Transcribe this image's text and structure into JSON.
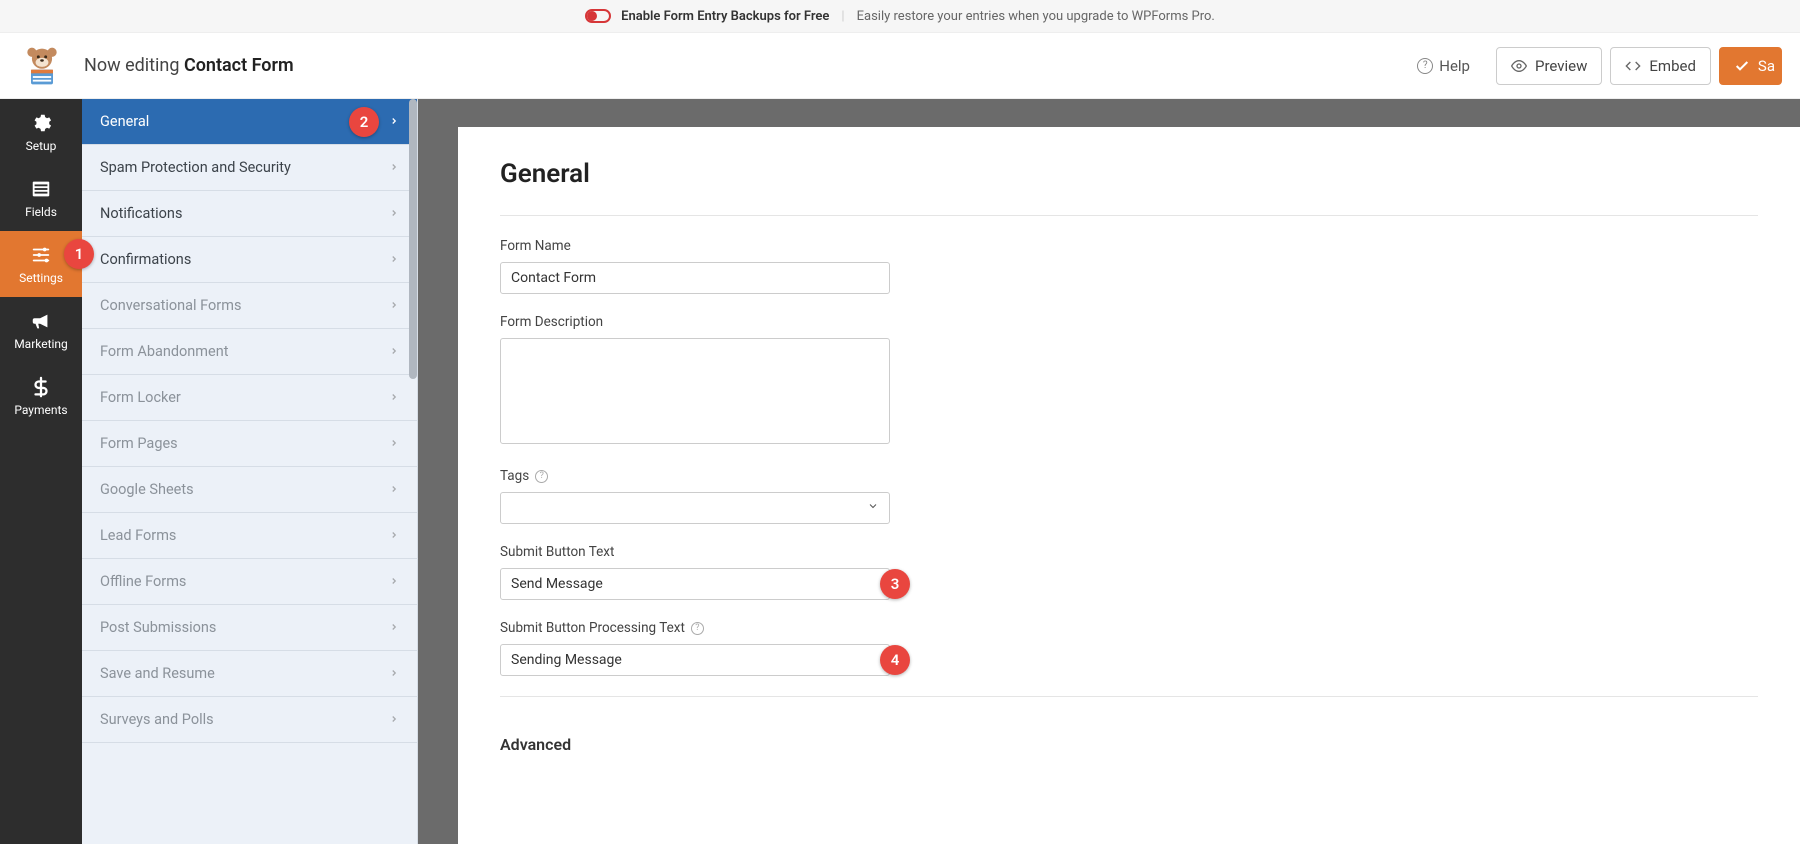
{
  "promo": {
    "title": "Enable Form Entry Backups for Free",
    "subtitle": "Easily restore your entries when you upgrade to WPForms Pro."
  },
  "header": {
    "editing_prefix": "Now editing",
    "form_name": "Contact Form",
    "help": "Help",
    "preview": "Preview",
    "embed": "Embed",
    "save": "Sa"
  },
  "rail": {
    "items": [
      {
        "label": "Setup",
        "icon": "gear"
      },
      {
        "label": "Fields",
        "icon": "list"
      },
      {
        "label": "Settings",
        "icon": "sliders",
        "active": true,
        "badge": "1"
      },
      {
        "label": "Marketing",
        "icon": "bullhorn"
      },
      {
        "label": "Payments",
        "icon": "dollar"
      }
    ]
  },
  "sidebar": {
    "items": [
      {
        "label": "General",
        "active": true,
        "badge": "2"
      },
      {
        "label": "Spam Protection and Security"
      },
      {
        "label": "Notifications"
      },
      {
        "label": "Confirmations"
      },
      {
        "label": "Conversational Forms",
        "dim": true
      },
      {
        "label": "Form Abandonment",
        "dim": true
      },
      {
        "label": "Form Locker",
        "dim": true
      },
      {
        "label": "Form Pages",
        "dim": true
      },
      {
        "label": "Google Sheets",
        "dim": true
      },
      {
        "label": "Lead Forms",
        "dim": true
      },
      {
        "label": "Offline Forms",
        "dim": true
      },
      {
        "label": "Post Submissions",
        "dim": true
      },
      {
        "label": "Save and Resume",
        "dim": true
      },
      {
        "label": "Surveys and Polls",
        "dim": true
      }
    ]
  },
  "content": {
    "title": "General",
    "form_name_label": "Form Name",
    "form_name_value": "Contact Form",
    "form_desc_label": "Form Description",
    "form_desc_value": "",
    "tags_label": "Tags",
    "submit_text_label": "Submit Button Text",
    "submit_text_value": "Send Message",
    "submit_text_badge": "3",
    "processing_text_label": "Submit Button Processing Text",
    "processing_text_value": "Sending Message",
    "processing_text_badge": "4",
    "advanced_label": "Advanced"
  }
}
